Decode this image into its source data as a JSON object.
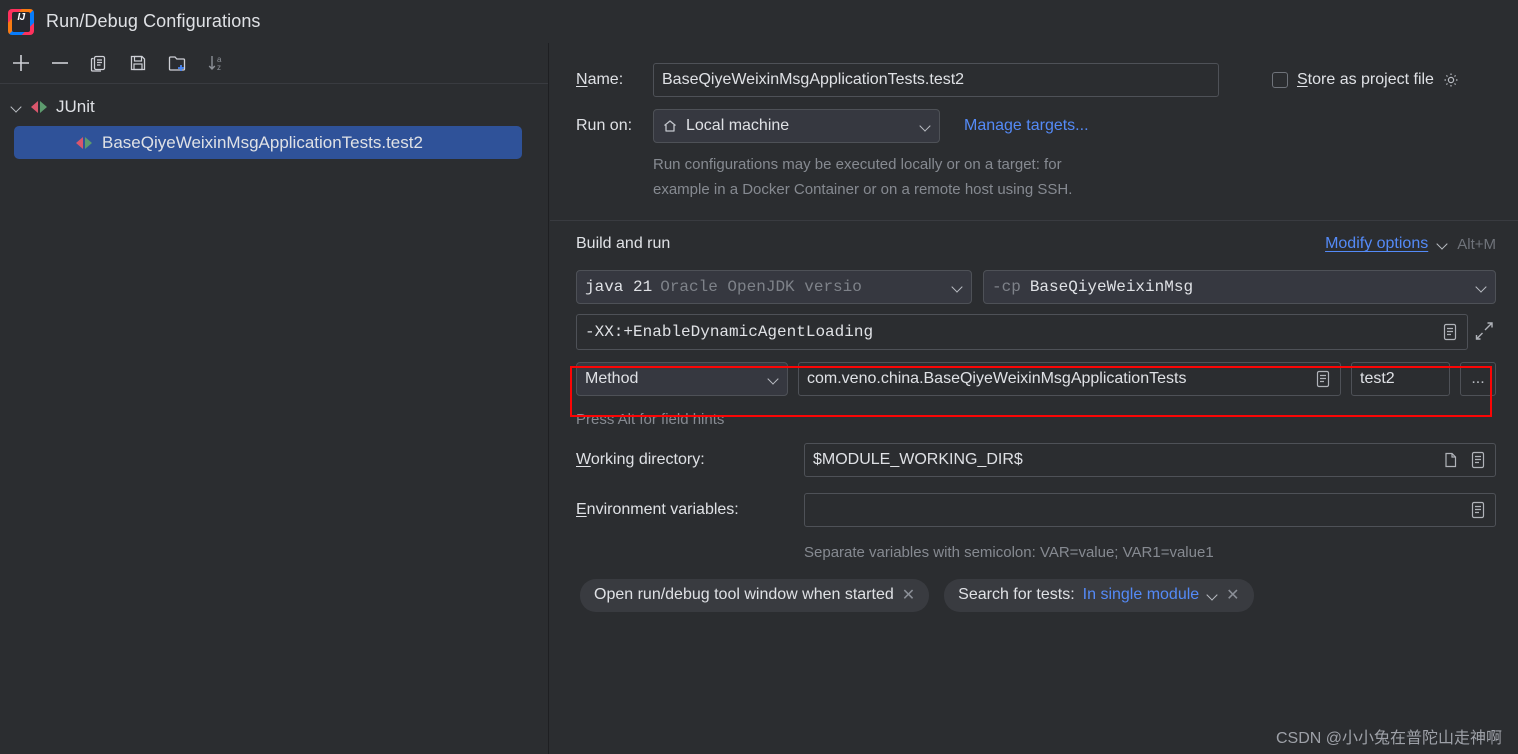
{
  "window": {
    "title": "Run/Debug Configurations",
    "logo_icon": "intellij-idea-logo",
    "logo_text": "IJ"
  },
  "toolbar": {
    "buttons": [
      {
        "name": "add-configuration",
        "icon": "plus-icon"
      },
      {
        "name": "remove-configuration",
        "icon": "minus-icon"
      },
      {
        "name": "copy-configuration",
        "icon": "copy-icon"
      },
      {
        "name": "save-configuration",
        "icon": "save-icon"
      },
      {
        "name": "new-folder",
        "icon": "new-folder-icon"
      },
      {
        "name": "sort-configurations",
        "icon": "sort-alphabetically-icon"
      }
    ]
  },
  "tree": {
    "group_label": "JUnit",
    "group_icon": "junit-run-icon",
    "expand_icon": "chevron-down-icon",
    "selected_item_label": "BaseQiyeWeixinMsgApplicationTests.test2",
    "selected_item_icon": "junit-run-icon"
  },
  "form": {
    "name_label": "Name:",
    "name_mnemonic": "N",
    "name_value": "BaseQiyeWeixinMsgApplicationTests.test2",
    "store_as_project_file_label": "Store as project file",
    "store_as_project_file_mnemonic": "S",
    "store_as_project_file_checked": false,
    "store_gear_icon": "gear-icon",
    "run_on_label": "Run on:",
    "run_on_value": "Local machine",
    "run_on_icon": "home-icon",
    "manage_targets_label": "Manage targets...",
    "run_on_hint_line1": "Run configurations may be executed locally or on a target: for",
    "run_on_hint_line2": "example in a Docker Container or on a remote host using SSH."
  },
  "build_and_run": {
    "section_title": "Build and run",
    "modify_options_label": "Modify options",
    "modify_options_shortcut": "Alt+M",
    "jdk_value_strong": "java 21",
    "jdk_value_dim": "Oracle OpenJDK versio",
    "classpath_prefix": "-cp",
    "classpath_value": "BaseQiyeWeixinMsg",
    "vm_options_value": "-XX:+EnableDynamicAgentLoading",
    "vm_options_expand_icon": "expand-icon",
    "vm_options_list_icon": "list-editor-icon",
    "kind_value": "Method",
    "class_value": "com.veno.china.BaseQiyeWeixinMsgApplicationTests",
    "class_list_icon": "list-editor-icon",
    "method_value": "test2",
    "browse_button_label": "...",
    "field_hint": "Press Alt for field hints"
  },
  "working_directory": {
    "label": "Working directory:",
    "mnemonic": "W",
    "value": "$MODULE_WORKING_DIR$",
    "folder_icon": "folder-icon",
    "list_icon": "list-editor-icon"
  },
  "environment_variables": {
    "label": "Environment variables:",
    "mnemonic": "E",
    "value": "",
    "list_icon": "list-editor-icon",
    "hint": "Separate variables with semicolon: VAR=value; VAR1=value1"
  },
  "option_chips": [
    {
      "name": "open-run-debug-tool-window-chip",
      "label": "Open run/debug tool window when started",
      "close_icon": "close-icon"
    }
  ],
  "search_chip": {
    "label": "Search for tests:",
    "value": "In single module",
    "chevron_icon": "chevron-down-icon",
    "close_icon": "close-icon"
  },
  "watermark": "CSDN @小小兔在普陀山走神啊",
  "colors": {
    "background": "#2b2d30",
    "selection": "#2f5299",
    "link": "#548af7",
    "annotation": "#fb0505",
    "border": "#4e5157"
  }
}
